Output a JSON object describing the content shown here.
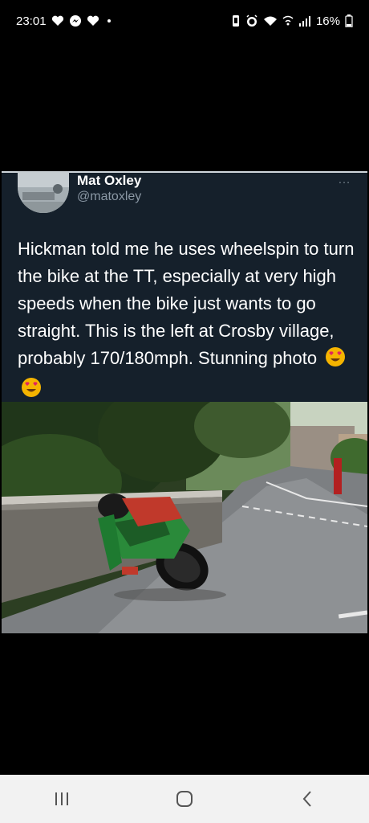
{
  "status_bar": {
    "time": "23:01",
    "battery": "16%",
    "icons_left": [
      "heart-icon",
      "messenger-icon",
      "heart-icon",
      "dot-icon"
    ],
    "icons_right": [
      "vibrate-icon",
      "alarm-icon",
      "wifi-icon",
      "wifi-calling-icon",
      "signal-icon",
      "battery-icon"
    ]
  },
  "tweet": {
    "author_name": "Mat Oxley",
    "author_handle": "@matoxley",
    "more": "…",
    "text": "Hickman told me he uses wheelspin to turn the bike at the TT, especially at very high speeds when the bike just wants to go straight. This is the left at Crosby village, probably 170/180mph. Stunning photo",
    "emoji": [
      "heart-eyes-emoji",
      "heart-eyes-emoji"
    ],
    "photo": "motorcycle-leaning-photo"
  },
  "nav_bar": {
    "buttons": [
      "recent-apps-icon",
      "home-icon",
      "back-icon"
    ]
  },
  "colors": {
    "background": "#000000",
    "tweet_bg": "#15202b",
    "handle": "#8b98a5",
    "nav_bar": "#f2f2f2"
  }
}
